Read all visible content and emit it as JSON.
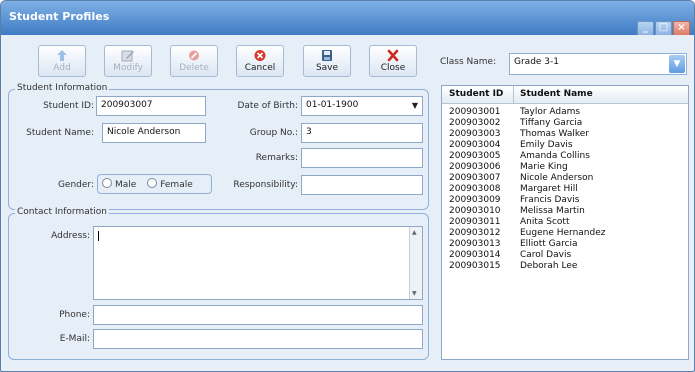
{
  "window": {
    "title": "Student Profiles"
  },
  "toolbar": {
    "buttons": [
      {
        "label": "Add",
        "enabled": false
      },
      {
        "label": "Modify",
        "enabled": false
      },
      {
        "label": "Delete",
        "enabled": false
      },
      {
        "label": "Cancel",
        "enabled": true
      },
      {
        "label": "Save",
        "enabled": true
      },
      {
        "label": "Close",
        "enabled": true
      }
    ]
  },
  "class_select": {
    "label": "Class Name:",
    "value": "Grade 3-1"
  },
  "student_info": {
    "title": "Student Information",
    "student_id_label": "Student ID:",
    "student_id": "200903007",
    "student_name_label": "Student Name:",
    "student_name": "Nicole Anderson",
    "dob_label": "Date of Birth:",
    "dob": "01-01-1900",
    "group_label": "Group No.:",
    "group": "3",
    "remarks_label": "Remarks:",
    "remarks": "",
    "responsibility_label": "Responsibility:",
    "responsibility": "",
    "gender_label": "Gender:",
    "gender_options": [
      "Male",
      "Female"
    ]
  },
  "contact_info": {
    "title": "Contact Information",
    "address_label": "Address:",
    "address": "",
    "phone_label": "Phone:",
    "phone": "",
    "email_label": "E-Mail:",
    "email": ""
  },
  "student_list": {
    "columns": [
      "Student ID",
      "Student Name"
    ],
    "rows": [
      [
        "200903001",
        "Taylor Adams"
      ],
      [
        "200903002",
        "Tiffany Garcia"
      ],
      [
        "200903003",
        "Thomas Walker"
      ],
      [
        "200903004",
        "Emily Davis"
      ],
      [
        "200903005",
        "Amanda Collins"
      ],
      [
        "200903006",
        "Marie King"
      ],
      [
        "200903007",
        "Nicole Anderson"
      ],
      [
        "200903008",
        "Margaret Hill"
      ],
      [
        "200903009",
        "Francis Davis"
      ],
      [
        "200903010",
        "Melissa Martin"
      ],
      [
        "200903011",
        "Anita Scott"
      ],
      [
        "200903012",
        "Eugene Hernandez"
      ],
      [
        "200903013",
        "Elliott Garcia"
      ],
      [
        "200903014",
        "Carol Davis"
      ],
      [
        "200903015",
        "Deborah Lee"
      ]
    ]
  },
  "colors": {
    "titlebar": "#4a86cc",
    "accent": "#3f7cc4",
    "window_bg": "#e6eef8"
  }
}
